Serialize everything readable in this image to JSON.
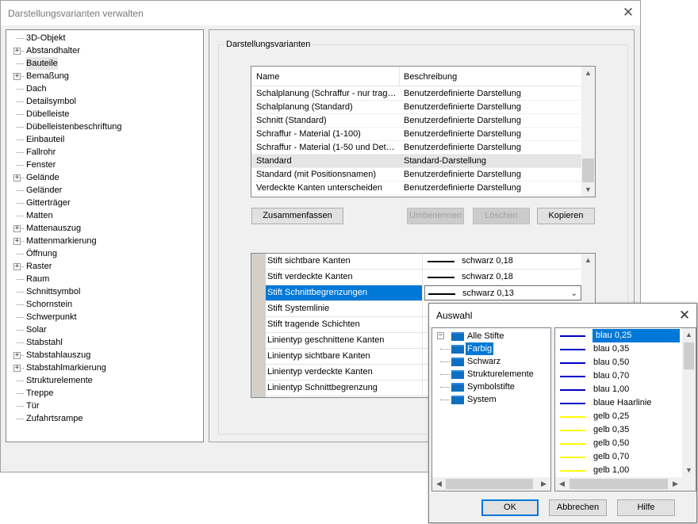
{
  "window": {
    "title": "Darstellungsvarianten verwalten",
    "close": "✕"
  },
  "tree": {
    "items": [
      {
        "label": "3D-Objekt",
        "expandable": false
      },
      {
        "label": "Abstandhalter",
        "expandable": true
      },
      {
        "label": "Bauteile",
        "expandable": false,
        "selected": true
      },
      {
        "label": "Bemaßung",
        "expandable": true
      },
      {
        "label": "Dach",
        "expandable": false
      },
      {
        "label": "Detailsymbol",
        "expandable": false
      },
      {
        "label": "Dübelleiste",
        "expandable": false
      },
      {
        "label": "Dübelleistenbeschriftung",
        "expandable": false
      },
      {
        "label": "Einbauteil",
        "expandable": false
      },
      {
        "label": "Fallrohr",
        "expandable": false
      },
      {
        "label": "Fenster",
        "expandable": false
      },
      {
        "label": "Gelände",
        "expandable": true
      },
      {
        "label": "Geländer",
        "expandable": false
      },
      {
        "label": "Gitterträger",
        "expandable": false
      },
      {
        "label": "Matten",
        "expandable": false
      },
      {
        "label": "Mattenauszug",
        "expandable": true
      },
      {
        "label": "Mattenmarkierung",
        "expandable": true
      },
      {
        "label": "Öffnung",
        "expandable": false
      },
      {
        "label": "Raster",
        "expandable": true
      },
      {
        "label": "Raum",
        "expandable": false
      },
      {
        "label": "Schnittsymbol",
        "expandable": false
      },
      {
        "label": "Schornstein",
        "expandable": false
      },
      {
        "label": "Schwerpunkt",
        "expandable": false
      },
      {
        "label": "Solar",
        "expandable": false
      },
      {
        "label": "Stabstahl",
        "expandable": false
      },
      {
        "label": "Stabstahlauszug",
        "expandable": true
      },
      {
        "label": "Stabstahlmarkierung",
        "expandable": true
      },
      {
        "label": "Strukturelemente",
        "expandable": false
      },
      {
        "label": "Treppe",
        "expandable": false
      },
      {
        "label": "Tür",
        "expandable": false
      },
      {
        "label": "Zufahrtsrampe",
        "expandable": false
      }
    ]
  },
  "group": {
    "title": "Darstellungsvarianten"
  },
  "variants": {
    "headers": {
      "name": "Name",
      "description": "Beschreibung"
    },
    "rows": [
      {
        "name": "Schalplanung (Schraffur - nur tragende Schichten)",
        "desc": "Benutzerdefinierte Darstellung",
        "selected": false
      },
      {
        "name": "Schalplanung (Standard)",
        "desc": "Benutzerdefinierte Darstellung",
        "selected": false
      },
      {
        "name": "Schnitt (Standard)",
        "desc": "Benutzerdefinierte Darstellung",
        "selected": false
      },
      {
        "name": "Schraffur - Material (1-100)",
        "desc": "Benutzerdefinierte Darstellung",
        "selected": false
      },
      {
        "name": "Schraffur - Material (1-50 und Detail)",
        "desc": "Benutzerdefinierte Darstellung",
        "selected": false
      },
      {
        "name": "Standard",
        "desc": "Standard-Darstellung",
        "selected": true
      },
      {
        "name": "Standard (mit Positionsnamen)",
        "desc": "Benutzerdefinierte Darstellung",
        "selected": false
      },
      {
        "name": "Verdeckte Kanten unterscheiden",
        "desc": "Benutzerdefinierte Darstellung",
        "selected": false
      }
    ]
  },
  "buttons": {
    "merge": "Zusammenfassen",
    "rename": "Umbenennen",
    "delete": "Löschen",
    "copy": "Kopieren"
  },
  "properties": [
    {
      "name": "Stift sichtbare Kanten",
      "value": "schwarz 0,18",
      "selected": false
    },
    {
      "name": "Stift verdeckte Kanten",
      "value": "schwarz 0,18",
      "selected": false
    },
    {
      "name": "Stift Schnittbegrenzungen",
      "value": "schwarz 0,13",
      "selected": true
    },
    {
      "name": "Stift Systemlinie",
      "value": "",
      "selected": false
    },
    {
      "name": "Stift tragende Schichten",
      "value": "",
      "selected": false
    },
    {
      "name": "Linientyp geschnittene Kanten",
      "value": "",
      "selected": false
    },
    {
      "name": "Linientyp sichtbare Kanten",
      "value": "",
      "selected": false
    },
    {
      "name": "Linientyp verdeckte Kanten",
      "value": "",
      "selected": false
    },
    {
      "name": "Linientyp Schnittbegrenzung",
      "value": "",
      "selected": false
    }
  ],
  "popup": {
    "title": "Auswahl",
    "tree": {
      "root": "Alle Stifte",
      "children": [
        "Farbig",
        "Schwarz",
        "Strukturelemente",
        "Symbolstifte",
        "System"
      ],
      "selected": "Farbig"
    },
    "pens": [
      {
        "label": "blau 0,25",
        "color": "#0000c8",
        "selected": true
      },
      {
        "label": "blau 0,35",
        "color": "#0000c8",
        "selected": false
      },
      {
        "label": "blau 0,50",
        "color": "#0000c8",
        "selected": false
      },
      {
        "label": "blau 0,70",
        "color": "#0000c8",
        "selected": false
      },
      {
        "label": "blau 1,00",
        "color": "#0000c8",
        "selected": false
      },
      {
        "label": "blaue Haarlinie",
        "color": "#0000c8",
        "selected": false
      },
      {
        "label": "gelb 0,25",
        "color": "#ffff00",
        "selected": false
      },
      {
        "label": "gelb 0,35",
        "color": "#ffff00",
        "selected": false
      },
      {
        "label": "gelb 0,50",
        "color": "#ffff00",
        "selected": false
      },
      {
        "label": "gelb 0,70",
        "color": "#ffff00",
        "selected": false
      },
      {
        "label": "gelb 1,00",
        "color": "#ffff00",
        "selected": false
      }
    ],
    "ok": "OK",
    "cancel": "Abbrechen",
    "help": "Hilfe"
  },
  "colors": {
    "accent": "#0078d7",
    "folder": "#0e6fc0"
  }
}
